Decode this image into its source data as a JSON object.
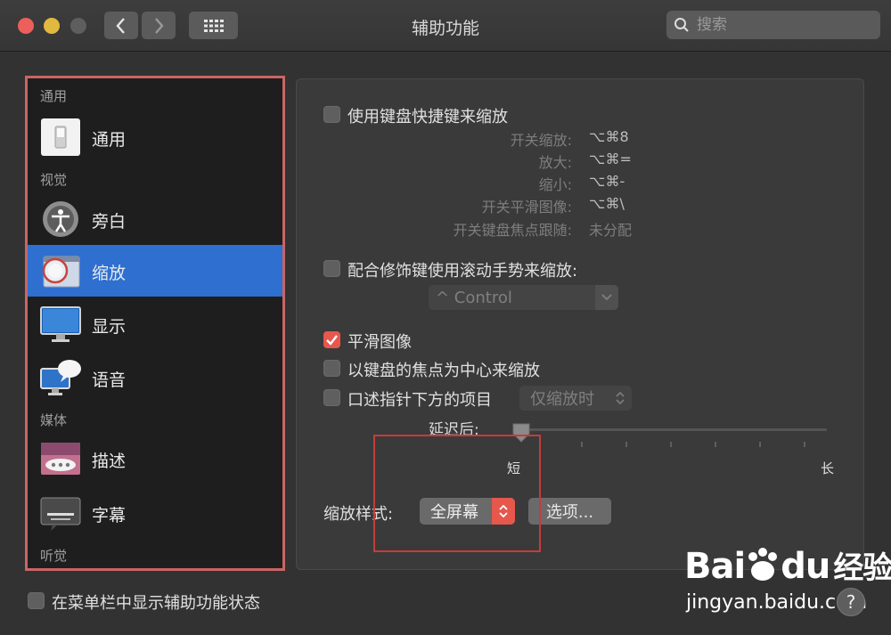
{
  "window": {
    "title": "辅助功能"
  },
  "search": {
    "placeholder": "搜索"
  },
  "sidebar": {
    "sections": {
      "general": "通用",
      "vision": "视觉",
      "media": "媒体",
      "hearing": "听觉"
    },
    "items": [
      {
        "label": "通用",
        "icon": "general-switch-icon"
      },
      {
        "label": "旁白",
        "icon": "voiceover-icon"
      },
      {
        "label": "缩放",
        "icon": "zoom-icon",
        "selected": true
      },
      {
        "label": "显示",
        "icon": "display-icon"
      },
      {
        "label": "语音",
        "icon": "speech-icon"
      },
      {
        "label": "描述",
        "icon": "descriptions-icon"
      },
      {
        "label": "字幕",
        "icon": "captions-icon"
      }
    ]
  },
  "zoom": {
    "keyboard_shortcuts": {
      "label": "使用键盘快捷键来缩放",
      "checked": false,
      "rows": [
        {
          "name": "开关缩放:",
          "keys": "⌥⌘8"
        },
        {
          "name": "放大:",
          "keys": "⌥⌘="
        },
        {
          "name": "缩小:",
          "keys": "⌥⌘-"
        },
        {
          "name": "开关平滑图像:",
          "keys": "⌥⌘\\"
        },
        {
          "name": "开关键盘焦点跟随:",
          "keys": "未分配"
        }
      ]
    },
    "scroll_gesture": {
      "label": "配合修饰键使用滚动手势来缩放:",
      "checked": false,
      "modifier_value": "^ Control"
    },
    "smooth_images": {
      "label": "平滑图像",
      "checked": true
    },
    "follow_keyboard_focus": {
      "label": "以键盘的焦点为中心来缩放",
      "checked": false
    },
    "speak_under_pointer": {
      "label": "口述指针下方的项目",
      "checked": false,
      "popup_value": "仅缩放时"
    },
    "delay": {
      "label": "延迟后:",
      "min_label": "短",
      "max_label": "长",
      "value": 0
    },
    "zoom_style": {
      "label": "缩放样式:",
      "value": "全屏幕",
      "options_button": "选项..."
    }
  },
  "footer": {
    "menu_bar_status": {
      "label": "在菜单栏中显示辅助功能状态",
      "checked": false
    }
  },
  "watermark": {
    "brand_left": "Bai",
    "brand_right": "du",
    "brand_suffix": "经验",
    "url": "jingyan.baidu.com"
  },
  "colors": {
    "accent": "#2e6fd0",
    "checkbox_checked": "#e6574c",
    "annotation": "#c73b3b"
  }
}
